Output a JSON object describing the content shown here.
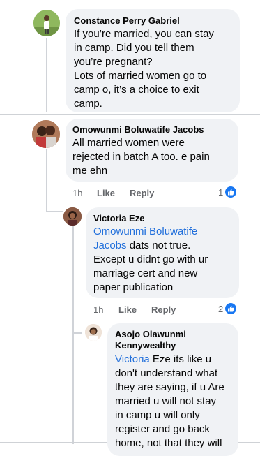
{
  "comments": [
    {
      "author": "Constance Perry Gabriel",
      "lines": [
        "If you’re married, you can stay",
        "in camp. Did you tell them",
        "you’re pregnant?",
        "Lots of married women go to",
        "camp o, it’s a choice to exit",
        "camp."
      ]
    },
    {
      "author": "Omowunmi Boluwatife Jacobs",
      "lines": [
        "All married women were",
        "rejected in batch A too. e pain",
        "me ehn"
      ],
      "time": "1h",
      "like_label": "Like",
      "reply_label": "Reply",
      "reaction_count": "1"
    },
    {
      "author": "Victoria Eze",
      "mention_line1": "Omowunmi Boluwatife",
      "mention_line2": "Jacobs",
      "line2_rest": " dats not true.",
      "lines": [
        "Except u didnt go with ur",
        "marriage cert and new",
        "paper publication"
      ],
      "time": "1h",
      "like_label": "Like",
      "reply_label": "Reply",
      "reaction_count": "2"
    },
    {
      "author_line1": "Asojo Olawunmi",
      "author_line2": "Kennywealthy",
      "mention": "Victoria",
      "line1_rest": " Eze its like u",
      "lines": [
        "don't understand what",
        "they are saying, if u Are",
        "married u will not stay",
        "in camp u will only",
        "register and go back",
        "home, not that they will"
      ]
    }
  ],
  "colors": {
    "bubble": "#f0f2f5",
    "mention": "#216fdb",
    "like_blue": "#1877f2",
    "meta_gray": "#65676b"
  }
}
